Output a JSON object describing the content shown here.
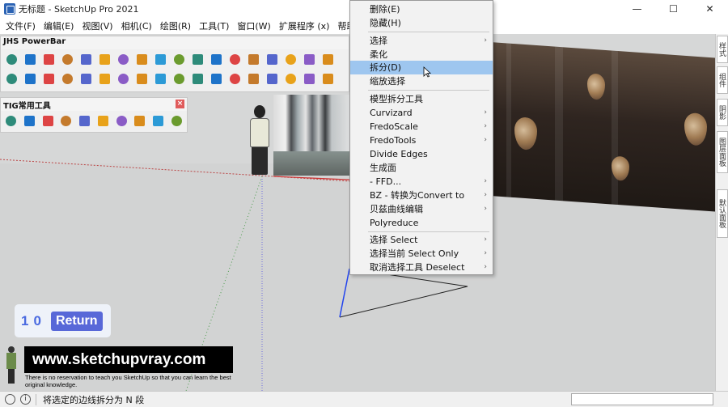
{
  "window": {
    "title": "无标题 - SketchUp Pro 2021",
    "minimize": "—",
    "maximize": "☐",
    "close": "✕"
  },
  "menubar": [
    "文件(F)",
    "编辑(E)",
    "视图(V)",
    "相机(C)",
    "绘图(R)",
    "工具(T)",
    "窗口(W)",
    "扩展程序 (x)",
    "帮助(H)"
  ],
  "toolbars": {
    "powerbar": {
      "title": "JHS PowerBar",
      "row1_count": 20,
      "row2_count": 20
    },
    "tig": {
      "title": "TIG常用工具",
      "icon_count": 10,
      "close": "×"
    }
  },
  "context_menu": {
    "items": [
      {
        "label": "删除(E)",
        "submenu": false
      },
      {
        "label": "隐藏(H)",
        "submenu": false
      },
      {
        "label": "选择",
        "submenu": true
      },
      {
        "label": "柔化",
        "submenu": false
      },
      {
        "label": "拆分(D)",
        "submenu": false,
        "highlighted": true
      },
      {
        "label": "缩放选择",
        "submenu": false
      },
      {
        "label": "模型拆分工具",
        "submenu": false
      },
      {
        "label": "Curvizard",
        "submenu": true
      },
      {
        "label": "FredoScale",
        "submenu": true
      },
      {
        "label": "FredoTools",
        "submenu": true
      },
      {
        "label": "Divide Edges",
        "submenu": false
      },
      {
        "label": "生成面",
        "submenu": false
      },
      {
        "label": "- FFD...",
        "submenu": true
      },
      {
        "label": "BZ - 转换为Convert to",
        "submenu": true
      },
      {
        "label": "贝兹曲线编辑",
        "submenu": true
      },
      {
        "label": "Polyreduce",
        "submenu": false
      },
      {
        "label": "选择 Select",
        "submenu": true
      },
      {
        "label": "选择当前 Select Only",
        "submenu": true
      },
      {
        "label": "取消选择工具 Deselect",
        "submenu": true
      }
    ],
    "arrow": "›"
  },
  "side_tabs": [
    "样式",
    "组件",
    "阴影",
    "图层面板",
    "默认面板"
  ],
  "keypad": {
    "digits": [
      "1",
      "0"
    ],
    "return_label": "Return"
  },
  "brand": {
    "url": "www.sketchupvray.com",
    "tagline": "There is no reservation to teach you SketchUp so that you can learn the best original knowledge."
  },
  "statusbar": {
    "info_icon": "i",
    "status_text": "将选定的边线拆分为 N 段",
    "measurement_value": ""
  }
}
